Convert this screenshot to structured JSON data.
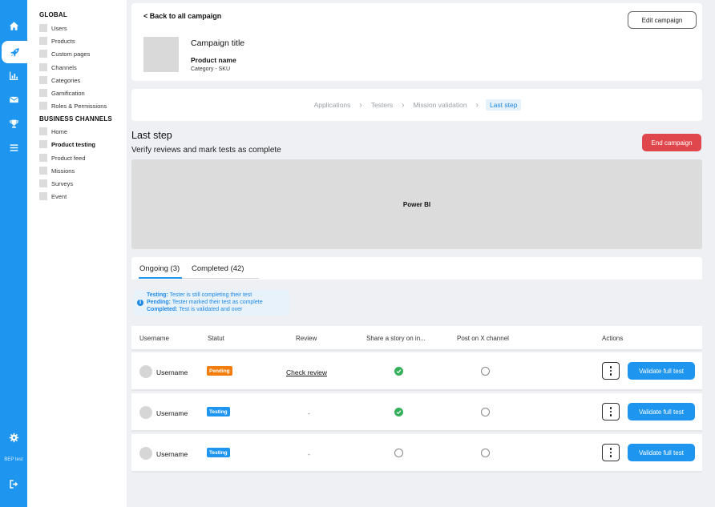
{
  "sidebar_rail": {
    "top_icons": [
      "home-icon",
      "rocket-icon",
      "bar-chart-icon",
      "mail-icon",
      "trophy-icon",
      "menu-icon"
    ],
    "active_icon": "rocket-icon",
    "bottom": {
      "settings_icon": "gear-icon",
      "user_label": "BEP test",
      "logout_icon": "logout-icon"
    },
    "color": "#1e96f0"
  },
  "nav": {
    "global_heading": "GLOBAL",
    "global_items": [
      "Users",
      "Products",
      "Custom pages",
      "Channels",
      "Categories",
      "Gamification",
      "Roles & Permissions"
    ],
    "business_heading": "BUSINESS CHANNELS",
    "business_items": [
      "Home",
      "Product testing",
      "Product feed",
      "Missions",
      "Surveys",
      "Event"
    ],
    "active_item": "Product testing"
  },
  "campaign": {
    "back_label": "< Back to all campaign",
    "edit_label": "Edit campaign",
    "title": "Campaign title",
    "product_name": "Product name",
    "category_sku": "Category - SKU"
  },
  "breadcrumb": {
    "steps": [
      "Applications",
      "Testers",
      "Mission validation",
      "Last step"
    ],
    "current": "Last step"
  },
  "step": {
    "title": "Last step",
    "subtitle": "Verify reviews and mark tests as complete",
    "end_label": "End campaign",
    "end_color": "#e0474c"
  },
  "powerbi_label": "Power BI",
  "tabs": [
    {
      "label": "Ongoing (3)",
      "active": true
    },
    {
      "label": "Completed (42)",
      "active": false
    }
  ],
  "legend": {
    "testing_key": "Testing:",
    "testing_text": " Tester is still completing their test",
    "pending_key": "Pending:",
    "pending_text": " Tester marked their test as complete",
    "completed_key": "Completed:",
    "completed_text": " Test is validated and over"
  },
  "table": {
    "headers": {
      "username": "Username",
      "statut": "Statut",
      "review": "Review",
      "share": "Share a story on in...",
      "post": "Post on X channel",
      "actions": "Actions"
    },
    "rows": [
      {
        "username": "Username",
        "status": "Pending",
        "review": "Check review",
        "share_done": true,
        "post_done": false,
        "action_label": "Validate full test"
      },
      {
        "username": "Username",
        "status": "Testing",
        "review": "-",
        "share_done": true,
        "post_done": false,
        "action_label": "Validate full test"
      },
      {
        "username": "Username",
        "status": "Testing",
        "review": "-",
        "share_done": false,
        "post_done": false,
        "action_label": "Validate full test"
      }
    ]
  },
  "colors": {
    "primary": "#1e96f0",
    "pending": "#f27d0c",
    "success": "#34b05a",
    "danger": "#e0474c"
  }
}
